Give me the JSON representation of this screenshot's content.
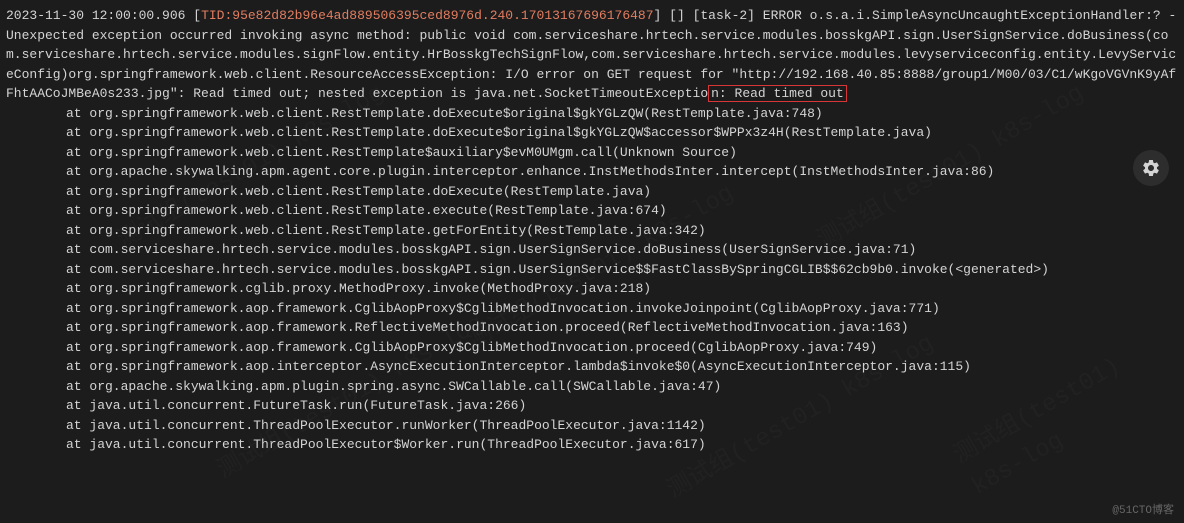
{
  "log": {
    "timestamp": "2023-11-30 12:00:00.906",
    "tid_prefix": "[",
    "tid": "TID:95e82d82b96e4ad889506395ced8976d.240.17013167696176487",
    "tid_suffix": "]",
    "brackets": " [] ",
    "task": "[task-2]",
    "level": " ERROR ",
    "message_part1": "o.s.a.i.SimpleAsyncUncaughtExceptionHandler:? - Unexpected exception occurred invoking async method: public void com.serviceshare.hrtech.service.modules.bosskgAPI.sign.UserSignService.doBusiness(com.serviceshare.hrtech.service.modules.signFlow.entity.HrBosskgTechSignFlow,com.serviceshare.hrtech.service.modules.levyserviceconfig.entity.LevyServiceConfig)org.springframework.web.client.ResourceAccessException: I/O error on GET request for \"http://192.168.40.85:8888/group1/M00/03/C1/wKgoVGVnK9yAfFhtAACoJMBeA0s233.jpg\": Read timed out; nested exception is java.net.SocketTimeoutExceptio",
    "highlighted": "n: Read timed out"
  },
  "stack": [
    "at org.springframework.web.client.RestTemplate.doExecute$original$gkYGLzQW(RestTemplate.java:748)",
    "at org.springframework.web.client.RestTemplate.doExecute$original$gkYGLzQW$accessor$WPPx3z4H(RestTemplate.java)",
    "at org.springframework.web.client.RestTemplate$auxiliary$evM0UMgm.call(Unknown Source)",
    "at org.apache.skywalking.apm.agent.core.plugin.interceptor.enhance.InstMethodsInter.intercept(InstMethodsInter.java:86)",
    "at org.springframework.web.client.RestTemplate.doExecute(RestTemplate.java)",
    "at org.springframework.web.client.RestTemplate.execute(RestTemplate.java:674)",
    "at org.springframework.web.client.RestTemplate.getForEntity(RestTemplate.java:342)",
    "at com.serviceshare.hrtech.service.modules.bosskgAPI.sign.UserSignService.doBusiness(UserSignService.java:71)",
    "at com.serviceshare.hrtech.service.modules.bosskgAPI.sign.UserSignService$$FastClassBySpringCGLIB$$62cb9b0.invoke(<generated>)",
    "at org.springframework.cglib.proxy.MethodProxy.invoke(MethodProxy.java:218)",
    "at org.springframework.aop.framework.CglibAopProxy$CglibMethodInvocation.invokeJoinpoint(CglibAopProxy.java:771)",
    "at org.springframework.aop.framework.ReflectiveMethodInvocation.proceed(ReflectiveMethodInvocation.java:163)",
    "at org.springframework.aop.framework.CglibAopProxy$CglibMethodInvocation.proceed(CglibAopProxy.java:749)",
    "at org.springframework.aop.interceptor.AsyncExecutionInterceptor.lambda$invoke$0(AsyncExecutionInterceptor.java:115)",
    "at org.apache.skywalking.apm.plugin.spring.async.SWCallable.call(SWCallable.java:47)",
    "at java.util.concurrent.FutureTask.run(FutureTask.java:266)",
    "at java.util.concurrent.ThreadPoolExecutor.runWorker(ThreadPoolExecutor.java:1142)",
    "at java.util.concurrent.ThreadPoolExecutor$Worker.run(ThreadPoolExecutor.java:617)"
  ],
  "watermark_text": "@51CTO博客",
  "bg_watermark": "测试组(test01) k8s-log"
}
